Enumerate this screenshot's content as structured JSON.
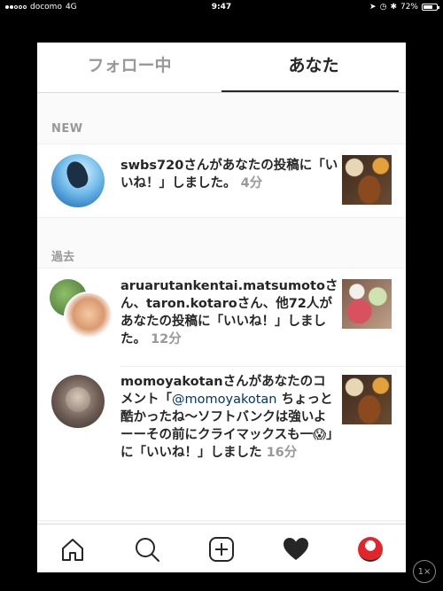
{
  "status_bar": {
    "carrier": "docomo",
    "network": "4G",
    "time": "9:47",
    "battery": "72%",
    "battery_level": 0.72
  },
  "tabs": [
    {
      "label": "フォロー中",
      "active": false
    },
    {
      "label": "あなた",
      "active": true
    }
  ],
  "sections": {
    "new_label": "NEW",
    "past_label": "過去"
  },
  "notifications": [
    {
      "username": "swbs720",
      "text": "さんがあなたの投稿に「いいね！」しました。",
      "time": "4分",
      "thumbnail": "food-katsu"
    },
    {
      "username": "aruarutankentai.matsumoto",
      "sep": "さん、",
      "username2": "taron.kotaro",
      "text": "さん、他72人があなたの投稿に「いいね！」しました。",
      "time": "12分",
      "thumbnail": "food-meat"
    },
    {
      "username": "momoyakotan",
      "text_before": "さんがあなたのコメント「",
      "mention": "@momoyakotan",
      "text_after": " ちょっと酷かったね〜ソフトバンクは強いよーーその前にクライマックスも一😱」に「いいね！」しました",
      "time": "16分",
      "thumbnail": "food-katsu"
    }
  ],
  "bottom_nav": {
    "items": [
      "home-icon",
      "search-icon",
      "add-icon",
      "heart-icon",
      "profile-avatar"
    ]
  },
  "zoom_button": "1×"
}
